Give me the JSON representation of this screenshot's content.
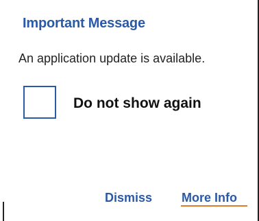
{
  "dialog": {
    "title": "Important Message",
    "message": "An application update is available.",
    "checkbox": {
      "label": "Do not show again",
      "checked": false
    },
    "buttons": {
      "dismiss_label": "Dismiss",
      "more_info_label": "More Info"
    }
  },
  "colors": {
    "accent": "#2a5aa7",
    "focus_underline": "#e07a2a",
    "text": "#222222",
    "background": "#ffffff"
  }
}
